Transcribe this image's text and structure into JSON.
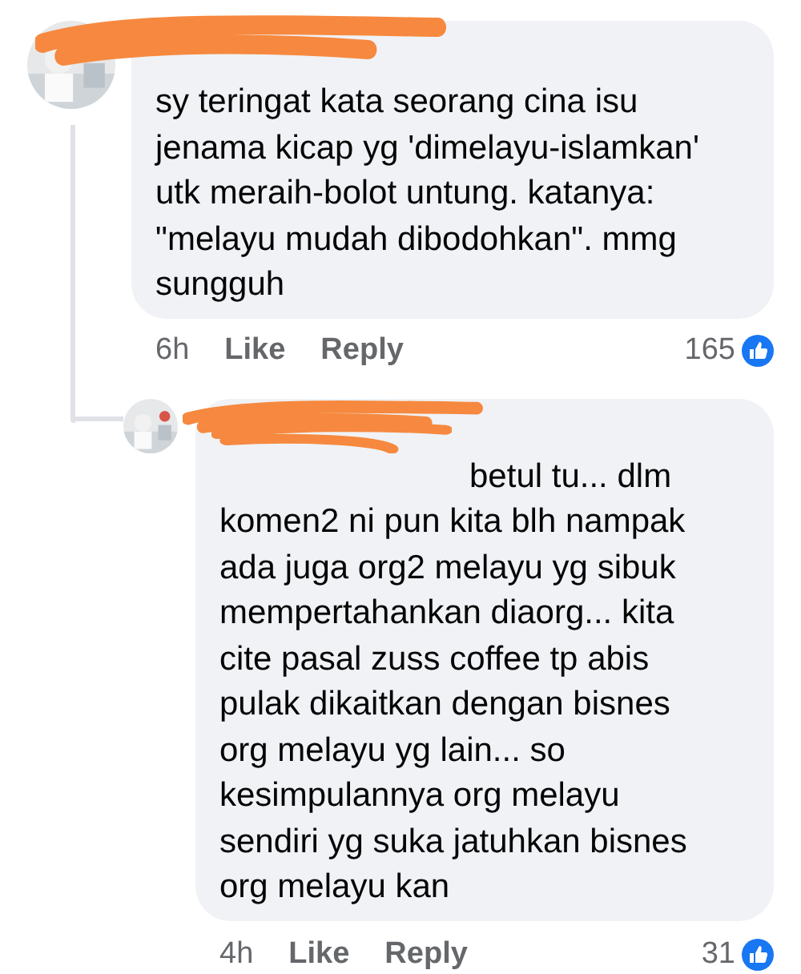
{
  "comments": [
    {
      "text": "sy teringat kata seorang cina isu jenama kicap yg 'dimelayu-islamkan' utk meraih-bolot untung. katanya: \"melayu mudah dibodohkan\". mmg sungguh",
      "time": "6h",
      "like_label": "Like",
      "reply_label": "Reply",
      "reaction_count": "165",
      "kind": "top"
    },
    {
      "text": "betul tu... dlm komen2 ni pun kita blh nampak ada juga org2 melayu yg sibuk mempertahankan diaorg... kita cite pasal zuss coffee tp abis pulak dikaitkan dengan bisnes org melayu yg lain... so kesimpulannya org melayu sendiri yg suka jatuhkan bisnes org melayu kan",
      "time": "4h",
      "like_label": "Like",
      "reply_label": "Reply",
      "reaction_count": "31",
      "kind": "reply"
    }
  ]
}
